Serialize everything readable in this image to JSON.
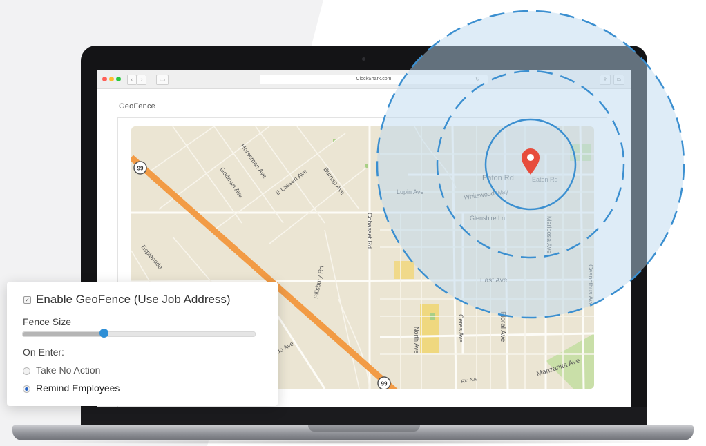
{
  "browser": {
    "url": "ClockShark.com",
    "nav_back": "‹",
    "nav_forward": "›",
    "reload_icon": "reload-icon",
    "share_icon": "share-icon",
    "tabs_icon": "tabs-icon"
  },
  "page": {
    "title": "GeoFence"
  },
  "map": {
    "streets": [
      "Horseman Ave",
      "Godman Ave",
      "E Lassen Ave",
      "Burnap Ave",
      "Esplanade",
      "Pillsbury Rd",
      "Cohasset Rd",
      "Lupin Ave",
      "Eaton Rd",
      "Eaton Rd",
      "Whitewood Way",
      "Glenshire Ln",
      "Mariposa Ave",
      "East Ave",
      "Ceanothus Ave",
      "Ceres Ave",
      "North Ave",
      "Floral Ave",
      "Manzanita Ave",
      "Rio Ave",
      "do Ave"
    ],
    "highway_shield": "99",
    "pin_color": "#e74c3c",
    "geofence_color": "#3b8fd0"
  },
  "settings": {
    "enable_label": "Enable GeoFence (Use Job Address)",
    "enable_checked": true,
    "fence_size_label": "Fence Size",
    "fence_size_value": 0.35,
    "on_enter_label": "On Enter:",
    "options": [
      {
        "label": "Take No Action",
        "selected": false
      },
      {
        "label": "Remind Employees",
        "selected": true
      }
    ]
  }
}
